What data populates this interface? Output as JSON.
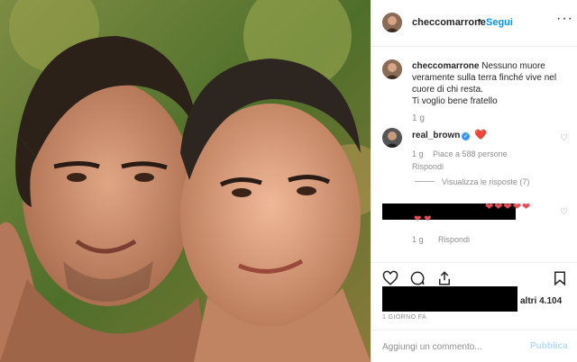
{
  "post": {
    "image_alt_icon": "photo-of-two-men"
  },
  "header": {
    "username": "checcomarrone",
    "dot": "•",
    "follow_label": "Segui",
    "more_icon": "ellipsis-icon",
    "more_glyph": "···"
  },
  "caption": {
    "username": "checcomarrone",
    "text_line1": "Nessuno muore veramente sulla terra finché vive nel cuore di chi resta.",
    "text_line2": "Ti voglio bene fratello",
    "time": "1 g"
  },
  "comments": [
    {
      "username": "real_brown",
      "verified_glyph": "✓",
      "text": "❤️",
      "time": "1 g",
      "likes": "Piace a 588 persone",
      "reply_label": "Rispondi",
      "view_replies": "Visualizza le risposte (7)"
    },
    {
      "hearts_top": "❤❤❤❤❤",
      "hearts_bottom": "❤ ❤",
      "time": "1 g",
      "reply_label": "Rispondi"
    }
  ],
  "engagement": {
    "likes_count_text": "altri 4.104",
    "time_ago": "1 GIORNO FA"
  },
  "composer": {
    "placeholder": "Aggiungi un commento...",
    "post_label": "Pubblica"
  },
  "colors": {
    "accent": "#0095f6",
    "heart": "#ed4956",
    "muted": "#8e8e8e"
  }
}
